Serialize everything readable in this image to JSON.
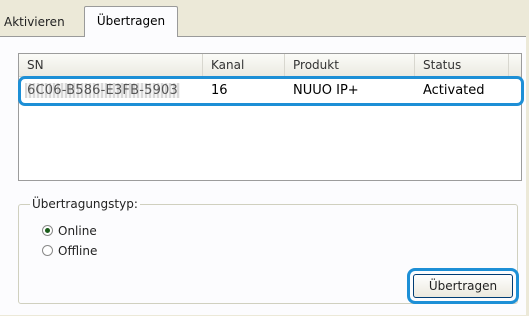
{
  "tabs": [
    {
      "label": "Aktivieren"
    },
    {
      "label": "Übertragen"
    }
  ],
  "list": {
    "columns": [
      "SN",
      "Kanal",
      "Produkt",
      "Status"
    ],
    "rows": [
      {
        "sn": "6C06-B586-E3FB-5903",
        "kanal": "16",
        "produkt": "NUUO IP+",
        "status": "Activated"
      }
    ]
  },
  "transfer": {
    "group_title": "Übertragungstyp:",
    "options": [
      {
        "label": "Online",
        "checked": true
      },
      {
        "label": "Offline",
        "checked": false
      }
    ],
    "button_label": "Übertragen"
  },
  "colors": {
    "highlight": "#1d8fd6",
    "background": "#ece9d8",
    "panel": "#fcfcfe"
  }
}
